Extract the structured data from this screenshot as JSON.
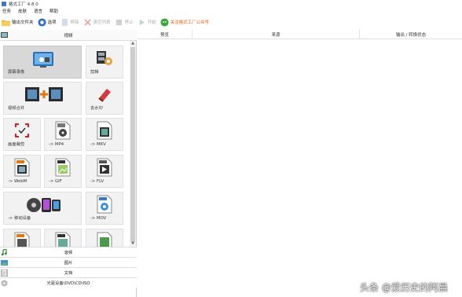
{
  "window": {
    "title": "格式工厂 4.8.0"
  },
  "menu": [
    "任务",
    "皮肤",
    "语言",
    "帮助"
  ],
  "toolbar": {
    "output_folder": "输出文件夹",
    "options": "选项",
    "remove": "移除",
    "clear_list": "清空列表",
    "stop": "停止",
    "start": "开始",
    "wechat": "关注格式工厂公众号"
  },
  "video_section": {
    "label": "视频"
  },
  "tiles": [
    {
      "label": "屏幕录像",
      "icon": "screen-record-icon"
    },
    {
      "label": "剪辑",
      "icon": "film-edit-icon"
    },
    {
      "label": "视频合并",
      "icon": "video-merge-icon"
    },
    {
      "label": "去水印",
      "icon": "eraser-icon"
    },
    {
      "label": "画面裁剪",
      "icon": "crop-icon"
    },
    {
      "label": "-> MP4",
      "icon": "mp4-icon"
    },
    {
      "label": "-> MKV",
      "icon": "mkv-icon"
    },
    {
      "label": "-> WebM",
      "icon": "webm-icon"
    },
    {
      "label": "-> GIF",
      "icon": "gif-icon"
    },
    {
      "label": "-> FLV",
      "icon": "flv-icon"
    },
    {
      "label": "-> 移动设备",
      "icon": "mobile-device-icon"
    },
    {
      "label": "-> MOV",
      "icon": "mov-icon"
    },
    {
      "label": "",
      "icon": "format-icon-a"
    },
    {
      "label": "",
      "icon": "format-icon-b"
    },
    {
      "label": "",
      "icon": "format-icon-c"
    }
  ],
  "categories": [
    {
      "label": "音频",
      "icon": "music-note-icon"
    },
    {
      "label": "图片",
      "icon": "picture-icon"
    },
    {
      "label": "文档",
      "icon": "document-icon"
    },
    {
      "label": "光驱设备\\DVD\\CD\\ISO",
      "icon": "disc-icon"
    }
  ],
  "table": {
    "columns": [
      "预览",
      "来源",
      "输出 / 转换状态"
    ]
  },
  "watermark": "头条 @爱历史的阿晨"
}
